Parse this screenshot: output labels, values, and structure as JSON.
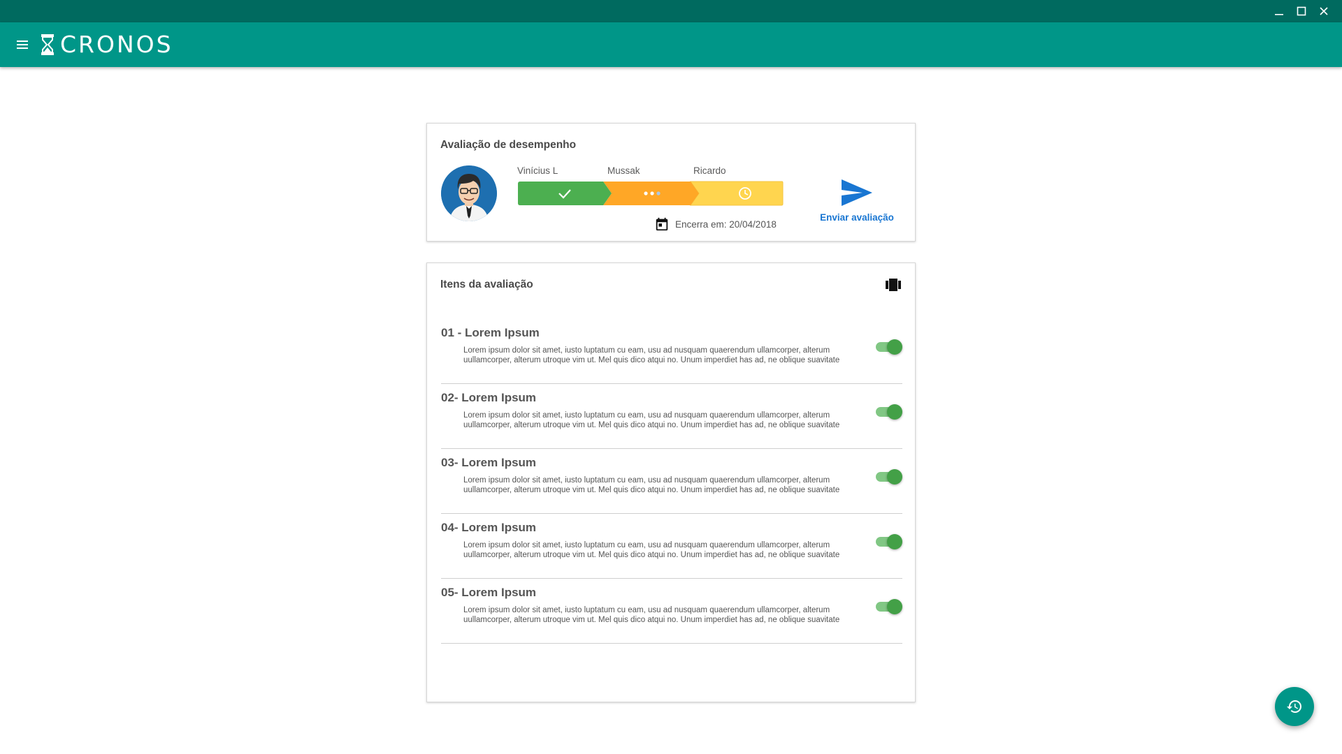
{
  "window": {
    "controls": {
      "minimize": "minimize-icon",
      "maximize": "maximize-icon",
      "close": "close-icon"
    }
  },
  "appbar": {
    "menu_icon": "hamburger-menu-icon",
    "logo_icon": "hourglass-icon",
    "logo_text": "CRONOS",
    "color": "#009688",
    "titlebar_color": "#006a5f"
  },
  "evaluation": {
    "title": "Avaliação de desempenho",
    "steps": [
      {
        "name": "Vinícius L",
        "status": "done",
        "icon": "check-icon",
        "color": "#4caf50"
      },
      {
        "name": "Mussak",
        "status": "in-progress",
        "icon": "more-dots-icon",
        "color": "#ffa726"
      },
      {
        "name": "Ricardo",
        "status": "pending",
        "icon": "clock-icon",
        "color": "#ffd54f"
      }
    ],
    "deadline_icon": "calendar-icon",
    "deadline": "Encerra em: 20/04/2018",
    "send_icon": "send-icon",
    "send_label": "Enviar avaliação",
    "send_color": "#1976d2"
  },
  "items": {
    "title": "Itens da avaliação",
    "header_icon": "view-carousel-icon",
    "list": [
      {
        "title": "01 - Lorem Ipsum",
        "description": "Lorem ipsum dolor sit amet, iusto luptatum cu eam, usu ad nusquam quaerendum ullamcorper, alterum uullamcorper, alterum utroque vim ut. Mel quis dico atqui no. Unum imperdiet has ad, ne oblique suavitate",
        "enabled": true
      },
      {
        "title": "02- Lorem Ipsum",
        "description": "Lorem ipsum dolor sit amet, iusto luptatum cu eam, usu ad nusquam quaerendum ullamcorper, alterum uullamcorper, alterum utroque vim ut. Mel quis dico atqui no. Unum imperdiet has ad, ne oblique suavitate",
        "enabled": true
      },
      {
        "title": "03- Lorem Ipsum",
        "description": "Lorem ipsum dolor sit amet, iusto luptatum cu eam, usu ad nusquam quaerendum ullamcorper, alterum uullamcorper, alterum utroque vim ut. Mel quis dico atqui no. Unum imperdiet has ad, ne oblique suavitate",
        "enabled": true
      },
      {
        "title": "04- Lorem Ipsum",
        "description": "Lorem ipsum dolor sit amet, iusto luptatum cu eam, usu ad nusquam quaerendum ullamcorper, alterum uullamcorper, alterum utroque vim ut. Mel quis dico atqui no. Unum imperdiet has ad, ne oblique suavitate",
        "enabled": true
      },
      {
        "title": "05- Lorem Ipsum",
        "description": "Lorem ipsum dolor sit amet, iusto luptatum cu eam, usu ad nusquam quaerendum ullamcorper, alterum uullamcorper, alterum utroque vim ut. Mel quis dico atqui no. Unum imperdiet has ad, ne oblique suavitate",
        "enabled": true
      }
    ],
    "toggle_on_color": "#43a047"
  },
  "fab": {
    "icon": "history-icon"
  }
}
